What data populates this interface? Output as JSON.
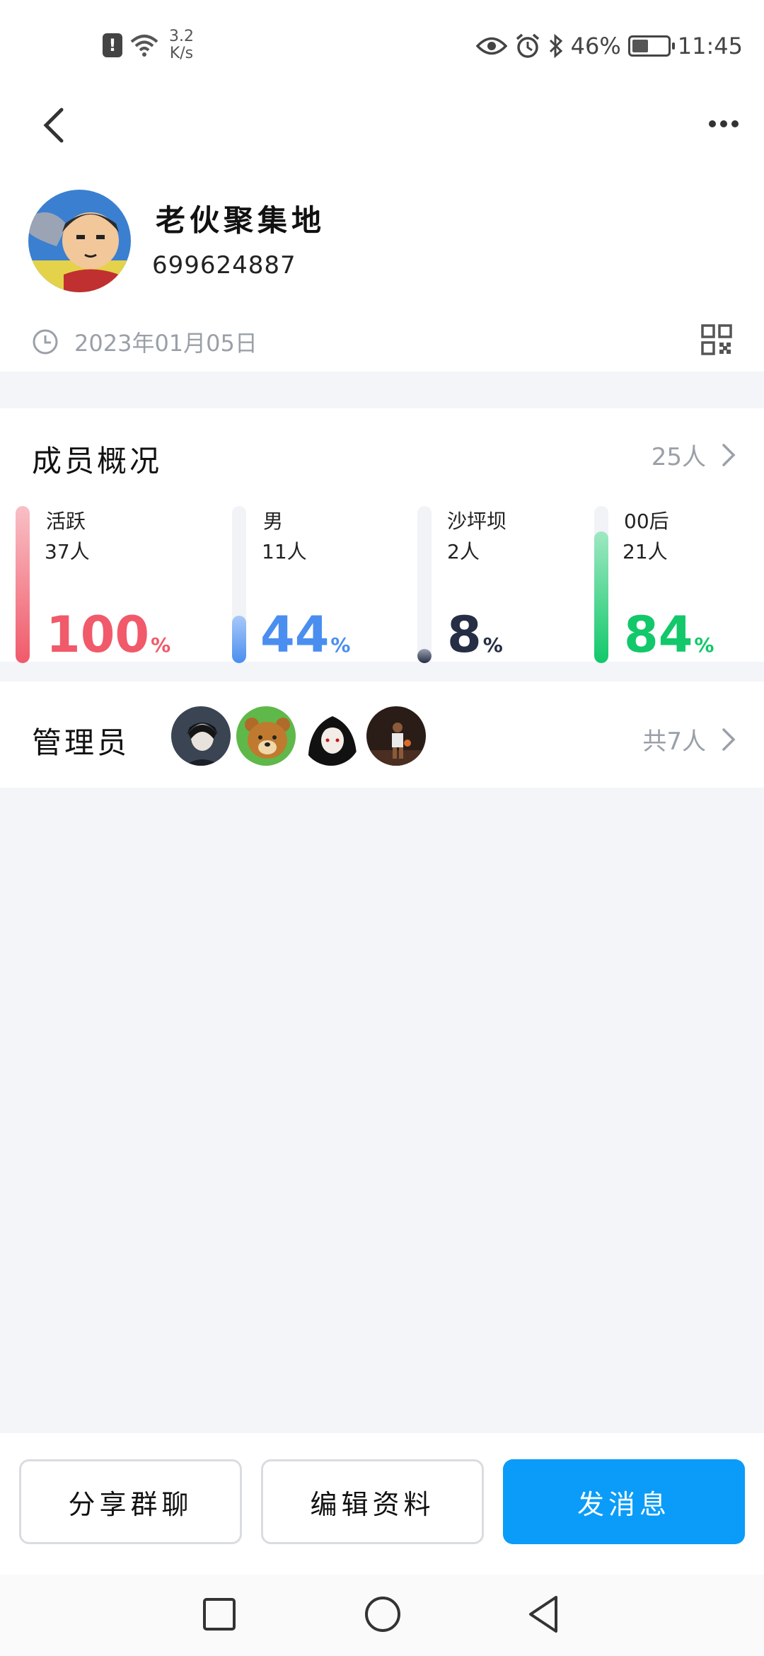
{
  "status_bar": {
    "net_speed_value": "3.2",
    "net_speed_unit": "K/s",
    "battery_percent": "46%",
    "battery_level": 0.46,
    "time": "11:45"
  },
  "group": {
    "name": "老伙聚集地",
    "id": "699624887",
    "created": "2023年01月05日"
  },
  "members": {
    "title": "成员概况",
    "total": "25人",
    "stats": [
      {
        "label": "活跃",
        "count": "37人",
        "percent": "100",
        "unit": "%",
        "level": 1.0,
        "color": "#f05a6a",
        "color_light": "#f9c0c6"
      },
      {
        "label": "男",
        "count": "11人",
        "percent": "44",
        "unit": "%",
        "level": 0.3,
        "color": "#4a8ef0",
        "color_light": "#a9c9f7"
      },
      {
        "label": "沙坪坝",
        "count": "2人",
        "percent": "8",
        "unit": "%",
        "level": 0.08,
        "color": "#262e45",
        "color_light": "#9aa0b0"
      },
      {
        "label": "00后",
        "count": "21人",
        "percent": "84",
        "unit": "%",
        "level": 0.84,
        "color": "#12c86a",
        "color_light": "#9ee8c2"
      }
    ]
  },
  "admins": {
    "title": "管理员",
    "total": "共7人"
  },
  "actions": {
    "share": "分享群聊",
    "edit": "编辑资料",
    "message": "发消息"
  },
  "icons": {
    "back": "chevron-left-icon",
    "more": "more-horizontal-icon",
    "clock": "clock-icon",
    "qr": "qr-code-icon",
    "chevron": "chevron-right-icon"
  }
}
